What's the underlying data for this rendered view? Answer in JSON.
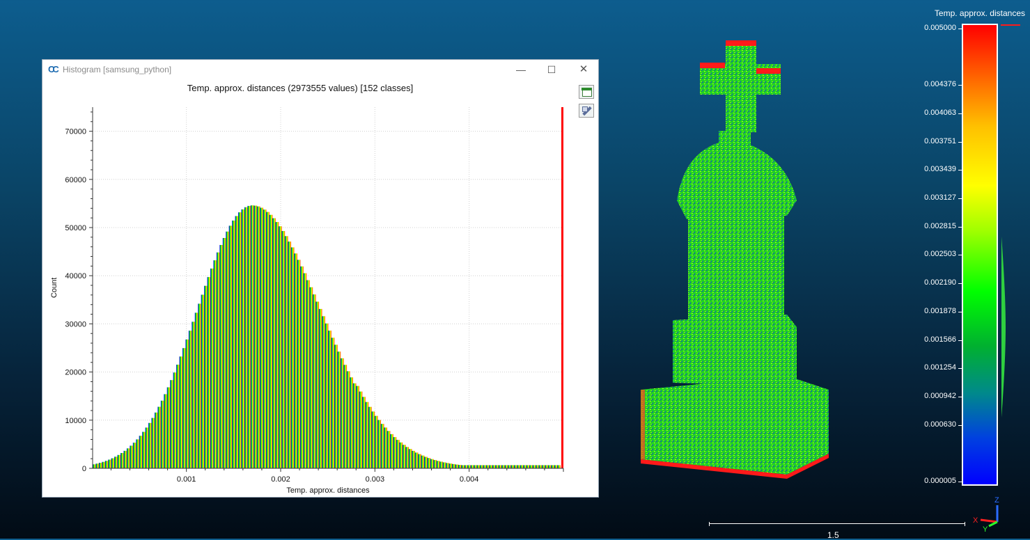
{
  "window": {
    "app_icon": "CC",
    "title": "Histogram [samsung_python]",
    "minimize_icon": "minimize-icon",
    "maximize_icon": "maximize-icon",
    "close_icon": "close-icon",
    "minimize_glyph": "—",
    "maximize_glyph": "☐",
    "close_glyph": "✕"
  },
  "toolbar": {
    "export_icon": "export-csv-icon",
    "settings_icon": "settings-wrench-icon"
  },
  "chart_data": {
    "type": "bar",
    "title": "Temp. approx. distances (2973555 values)  [152 classes]",
    "xlabel": "Temp. approx. distances",
    "ylabel": "Count",
    "xlim": [
      5e-06,
      0.005
    ],
    "ylim": [
      0,
      75000
    ],
    "x_ticks": [
      {
        "value": 0.001,
        "label": "0.001"
      },
      {
        "value": 0.002,
        "label": "0.002"
      },
      {
        "value": 0.003,
        "label": "0.003"
      },
      {
        "value": 0.004,
        "label": "0.004"
      }
    ],
    "y_ticks": [
      {
        "value": 0,
        "label": "0"
      },
      {
        "value": 10000,
        "label": "10000"
      },
      {
        "value": 20000,
        "label": "20000"
      },
      {
        "value": 30000,
        "label": "30000"
      },
      {
        "value": 40000,
        "label": "40000"
      },
      {
        "value": 50000,
        "label": "50000"
      },
      {
        "value": 60000,
        "label": "60000"
      },
      {
        "value": 70000,
        "label": "70000"
      }
    ],
    "grid": true,
    "num_classes": 152,
    "distribution": {
      "peak_x": 0.0017,
      "peak_count": 54600,
      "tail_count_at_max": 650
    },
    "last_class": {
      "x": 0.005,
      "count": 75000
    }
  },
  "color_scale": {
    "title": "Temp. approx. distances",
    "labels": [
      "0.005000",
      "0.004376",
      "0.004063",
      "0.003751",
      "0.003439",
      "0.003127",
      "0.002815",
      "0.002503",
      "0.002190",
      "0.001878",
      "0.001566",
      "0.001254",
      "0.000942",
      "0.000630",
      "0.000005"
    ],
    "label_values": [
      0.005,
      0.004376,
      0.004063,
      0.003751,
      0.003439,
      0.003127,
      0.002815,
      0.002503,
      0.00219,
      0.001878,
      0.001566,
      0.001254,
      0.000942,
      0.00063,
      5e-06
    ],
    "colors": [
      "#0000ff",
      "#008a8a",
      "#00ff00",
      "#ffff00",
      "#ff8000",
      "#ff0000"
    ]
  },
  "axes_trihedron": {
    "x": "X",
    "y": "Y",
    "z": "Z"
  },
  "scale_bar": {
    "label": "1.5"
  }
}
